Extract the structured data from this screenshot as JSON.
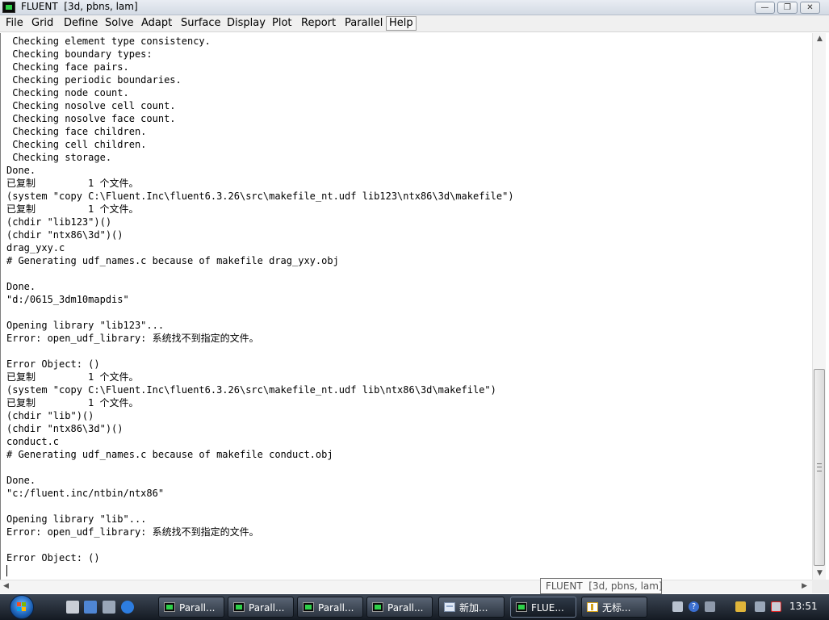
{
  "window": {
    "title": "FLUENT  [3d, pbns, lam]",
    "minimize": "—",
    "maximize": "❐",
    "close": "✕"
  },
  "menu": [
    "File",
    "Grid",
    "Define",
    "Solve",
    "Adapt",
    "Surface",
    "Display",
    "Plot",
    "Report",
    "Parallel",
    "Help"
  ],
  "console_lines": [
    " Checking element type consistency.",
    " Checking boundary types:",
    " Checking face pairs.",
    " Checking periodic boundaries.",
    " Checking node count.",
    " Checking nosolve cell count.",
    " Checking nosolve face count.",
    " Checking face children.",
    " Checking cell children.",
    " Checking storage.",
    "Done.",
    "已复制         1 个文件。",
    "(system \"copy C:\\Fluent.Inc\\fluent6.3.26\\src\\makefile_nt.udf lib123\\ntx86\\3d\\makefile\")",
    "已复制         1 个文件。",
    "(chdir \"lib123\")()",
    "(chdir \"ntx86\\3d\")()",
    "drag_yxy.c",
    "# Generating udf_names.c because of makefile drag_yxy.obj",
    "",
    "Done.",
    "\"d:/0615_3dm10mapdis\"",
    "",
    "Opening library \"lib123\"...",
    "Error: open_udf_library: 系统找不到指定的文件。",
    "",
    "Error Object: ()",
    "已复制         1 个文件。",
    "(system \"copy C:\\Fluent.Inc\\fluent6.3.26\\src\\makefile_nt.udf lib\\ntx86\\3d\\makefile\")",
    "已复制         1 个文件。",
    "(chdir \"lib\")()",
    "(chdir \"ntx86\\3d\")()",
    "conduct.c",
    "# Generating udf_names.c because of makefile conduct.obj",
    "",
    "Done.",
    "\"c:/fluent.inc/ntbin/ntx86\"",
    "",
    "Opening library \"lib\"...",
    "Error: open_udf_library: 系统找不到指定的文件。",
    "",
    "Error Object: ()"
  ],
  "tooltip": "FLUENT  [3d, pbns, lam]",
  "taskbar": {
    "tasks": [
      {
        "label": "Parall...",
        "icon": "fluent-icon",
        "active": false
      },
      {
        "label": "Parall...",
        "icon": "fluent-icon",
        "active": false
      },
      {
        "label": "Parall...",
        "icon": "fluent-icon",
        "active": false
      },
      {
        "label": "Parall...",
        "icon": "fluent-icon",
        "active": false
      },
      {
        "label": "新加...",
        "icon": "notepad-icon",
        "active": false
      },
      {
        "label": "FLUE...",
        "icon": "fluent-icon",
        "active": true
      },
      {
        "label": "无标...",
        "icon": "word-icon",
        "active": false
      }
    ],
    "clock": "13:51"
  },
  "colors": {
    "console_text": "#000000",
    "taskbar": "#1e2530",
    "accent_green": "#2fd14a"
  }
}
